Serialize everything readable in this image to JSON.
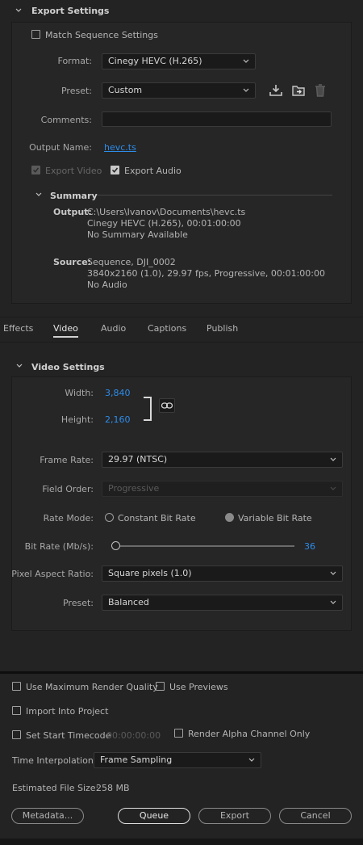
{
  "export_settings": {
    "title": "Export Settings",
    "match_sequence_label": "Match Sequence Settings",
    "format_label": "Format:",
    "format_value": "Cinegy HEVC (H.265)",
    "preset_label": "Preset:",
    "preset_value": "Custom",
    "comments_label": "Comments:",
    "comments_value": "",
    "output_name_label": "Output Name:",
    "output_name_value": "hevc.ts",
    "export_video_label": "Export Video",
    "export_audio_label": "Export Audio",
    "summary_title": "Summary",
    "output_key": "Output:",
    "output_lines": [
      "C:\\Users\\Ivanov\\Documents\\hevc.ts",
      "Cinegy HEVC (H.265), 00:01:00:00",
      "No Summary Available"
    ],
    "source_key": "Source:",
    "source_lines": [
      "Sequence, DJI_0002",
      "3840x2160 (1.0), 29.97 fps, Progressive, 00:01:00:00",
      "No Audio"
    ]
  },
  "tabs": [
    {
      "label": "Effects"
    },
    {
      "label": "Video"
    },
    {
      "label": "Audio"
    },
    {
      "label": "Captions"
    },
    {
      "label": "Publish"
    }
  ],
  "video_settings": {
    "title": "Video Settings",
    "width_label": "Width:",
    "width_value": "3,840",
    "height_label": "Height:",
    "height_value": "2,160",
    "frame_rate_label": "Frame Rate:",
    "frame_rate_value": "29.97 (NTSC)",
    "field_order_label": "Field Order:",
    "field_order_value": "Progressive",
    "rate_mode_label": "Rate Mode:",
    "constant_bit_rate_label": "Constant Bit Rate",
    "variable_bit_rate_label": "Variable Bit Rate",
    "bit_rate_label": "Bit Rate (Mb/s):",
    "bit_rate_value": "36",
    "bit_rate_fraction": 0.0,
    "pixel_aspect_label": "Pixel Aspect Ratio:",
    "pixel_aspect_value": "Square pixels (1.0)",
    "preset_label": "Preset:",
    "preset_value": "Balanced"
  },
  "bottom": {
    "max_render_quality_label": "Use Maximum Render Quality",
    "use_previews_label": "Use Previews",
    "import_into_project_label": "Import Into Project",
    "set_start_timecode_label": "Set Start Timecode",
    "start_timecode_value": "00:00:00:00",
    "render_alpha_label": "Render Alpha Channel Only",
    "time_interpolation_label": "Time Interpolation:",
    "time_interpolation_value": "Frame Sampling",
    "estimated_file_size_label": "Estimated File Size:",
    "estimated_file_size_value": "258 MB",
    "metadata_button": "Metadata...",
    "queue_button": "Queue",
    "export_button": "Export",
    "cancel_button": "Cancel"
  },
  "colors": {
    "accent_blue": "#2d8ceb",
    "background": "#232323",
    "panel": "#262626"
  }
}
